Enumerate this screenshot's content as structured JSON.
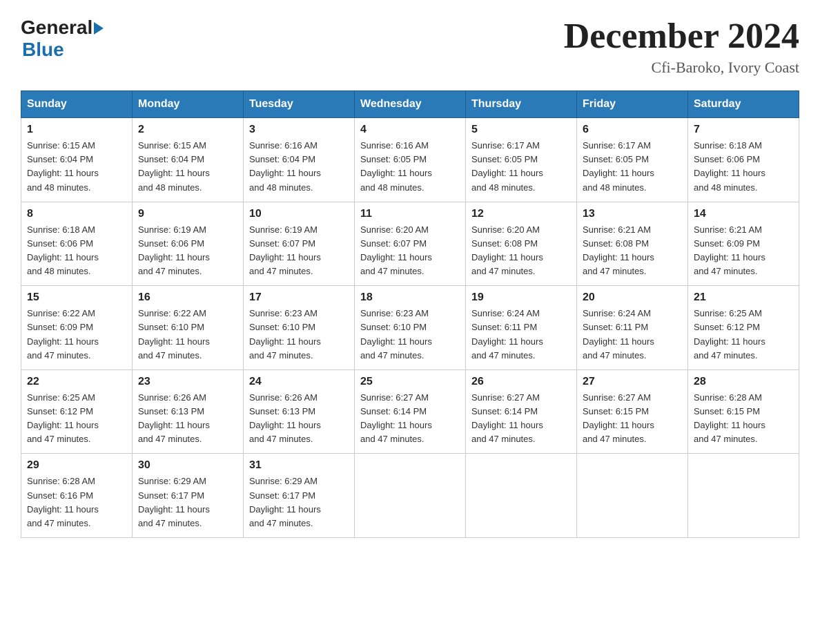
{
  "header": {
    "logo_general": "General",
    "logo_blue": "Blue",
    "title": "December 2024",
    "subtitle": "Cfi-Baroko, Ivory Coast"
  },
  "days_of_week": [
    "Sunday",
    "Monday",
    "Tuesday",
    "Wednesday",
    "Thursday",
    "Friday",
    "Saturday"
  ],
  "weeks": [
    [
      {
        "day": "1",
        "sunrise": "6:15 AM",
        "sunset": "6:04 PM",
        "daylight": "11 hours and 48 minutes."
      },
      {
        "day": "2",
        "sunrise": "6:15 AM",
        "sunset": "6:04 PM",
        "daylight": "11 hours and 48 minutes."
      },
      {
        "day": "3",
        "sunrise": "6:16 AM",
        "sunset": "6:04 PM",
        "daylight": "11 hours and 48 minutes."
      },
      {
        "day": "4",
        "sunrise": "6:16 AM",
        "sunset": "6:05 PM",
        "daylight": "11 hours and 48 minutes."
      },
      {
        "day": "5",
        "sunrise": "6:17 AM",
        "sunset": "6:05 PM",
        "daylight": "11 hours and 48 minutes."
      },
      {
        "day": "6",
        "sunrise": "6:17 AM",
        "sunset": "6:05 PM",
        "daylight": "11 hours and 48 minutes."
      },
      {
        "day": "7",
        "sunrise": "6:18 AM",
        "sunset": "6:06 PM",
        "daylight": "11 hours and 48 minutes."
      }
    ],
    [
      {
        "day": "8",
        "sunrise": "6:18 AM",
        "sunset": "6:06 PM",
        "daylight": "11 hours and 48 minutes."
      },
      {
        "day": "9",
        "sunrise": "6:19 AM",
        "sunset": "6:06 PM",
        "daylight": "11 hours and 47 minutes."
      },
      {
        "day": "10",
        "sunrise": "6:19 AM",
        "sunset": "6:07 PM",
        "daylight": "11 hours and 47 minutes."
      },
      {
        "day": "11",
        "sunrise": "6:20 AM",
        "sunset": "6:07 PM",
        "daylight": "11 hours and 47 minutes."
      },
      {
        "day": "12",
        "sunrise": "6:20 AM",
        "sunset": "6:08 PM",
        "daylight": "11 hours and 47 minutes."
      },
      {
        "day": "13",
        "sunrise": "6:21 AM",
        "sunset": "6:08 PM",
        "daylight": "11 hours and 47 minutes."
      },
      {
        "day": "14",
        "sunrise": "6:21 AM",
        "sunset": "6:09 PM",
        "daylight": "11 hours and 47 minutes."
      }
    ],
    [
      {
        "day": "15",
        "sunrise": "6:22 AM",
        "sunset": "6:09 PM",
        "daylight": "11 hours and 47 minutes."
      },
      {
        "day": "16",
        "sunrise": "6:22 AM",
        "sunset": "6:10 PM",
        "daylight": "11 hours and 47 minutes."
      },
      {
        "day": "17",
        "sunrise": "6:23 AM",
        "sunset": "6:10 PM",
        "daylight": "11 hours and 47 minutes."
      },
      {
        "day": "18",
        "sunrise": "6:23 AM",
        "sunset": "6:10 PM",
        "daylight": "11 hours and 47 minutes."
      },
      {
        "day": "19",
        "sunrise": "6:24 AM",
        "sunset": "6:11 PM",
        "daylight": "11 hours and 47 minutes."
      },
      {
        "day": "20",
        "sunrise": "6:24 AM",
        "sunset": "6:11 PM",
        "daylight": "11 hours and 47 minutes."
      },
      {
        "day": "21",
        "sunrise": "6:25 AM",
        "sunset": "6:12 PM",
        "daylight": "11 hours and 47 minutes."
      }
    ],
    [
      {
        "day": "22",
        "sunrise": "6:25 AM",
        "sunset": "6:12 PM",
        "daylight": "11 hours and 47 minutes."
      },
      {
        "day": "23",
        "sunrise": "6:26 AM",
        "sunset": "6:13 PM",
        "daylight": "11 hours and 47 minutes."
      },
      {
        "day": "24",
        "sunrise": "6:26 AM",
        "sunset": "6:13 PM",
        "daylight": "11 hours and 47 minutes."
      },
      {
        "day": "25",
        "sunrise": "6:27 AM",
        "sunset": "6:14 PM",
        "daylight": "11 hours and 47 minutes."
      },
      {
        "day": "26",
        "sunrise": "6:27 AM",
        "sunset": "6:14 PM",
        "daylight": "11 hours and 47 minutes."
      },
      {
        "day": "27",
        "sunrise": "6:27 AM",
        "sunset": "6:15 PM",
        "daylight": "11 hours and 47 minutes."
      },
      {
        "day": "28",
        "sunrise": "6:28 AM",
        "sunset": "6:15 PM",
        "daylight": "11 hours and 47 minutes."
      }
    ],
    [
      {
        "day": "29",
        "sunrise": "6:28 AM",
        "sunset": "6:16 PM",
        "daylight": "11 hours and 47 minutes."
      },
      {
        "day": "30",
        "sunrise": "6:29 AM",
        "sunset": "6:17 PM",
        "daylight": "11 hours and 47 minutes."
      },
      {
        "day": "31",
        "sunrise": "6:29 AM",
        "sunset": "6:17 PM",
        "daylight": "11 hours and 47 minutes."
      },
      null,
      null,
      null,
      null
    ]
  ],
  "labels": {
    "sunrise": "Sunrise:",
    "sunset": "Sunset:",
    "daylight": "Daylight:"
  }
}
